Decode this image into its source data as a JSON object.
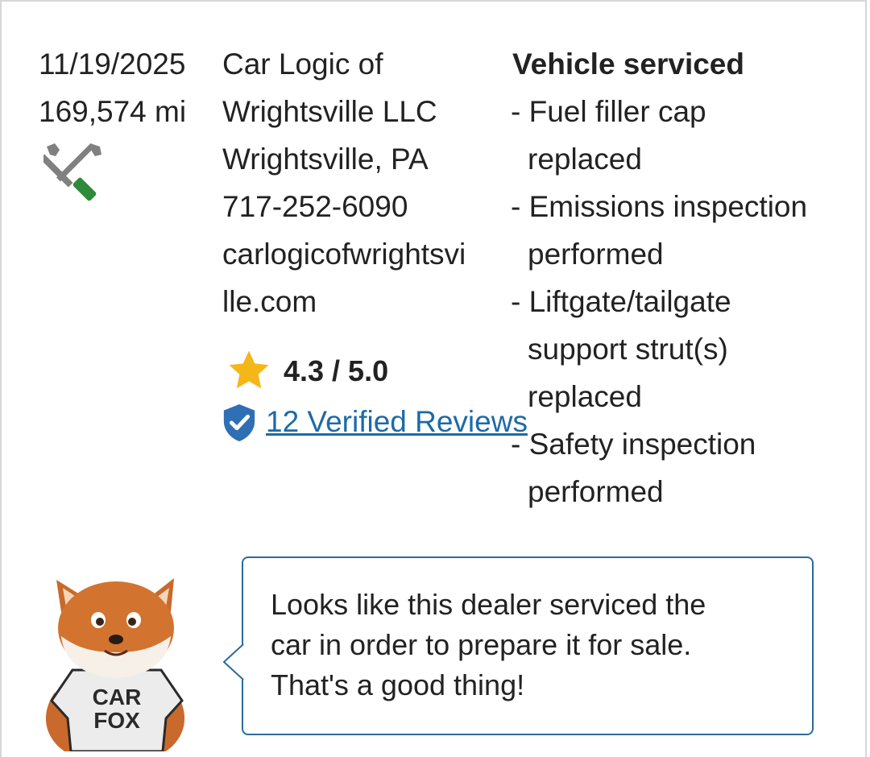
{
  "record": {
    "date": "11/19/2025",
    "mileage": "169,574 mi",
    "service_icon": "wrench-screwdriver-icon",
    "dealer": {
      "name_line1": "Car Logic of",
      "name_line2": "Wrightsville LLC",
      "location": "Wrightsville, PA",
      "phone": "717-252-6090",
      "website_line1": "carlogicofwrightsvi",
      "website_line2": "lle.com"
    },
    "rating": {
      "icon": "star-icon",
      "text": "4.3 / 5.0"
    },
    "reviews": {
      "icon": "verified-shield-icon",
      "link_text": "12 Verified Reviews"
    },
    "details": {
      "title": "Vehicle serviced",
      "lines": [
        "- Fuel filler cap",
        "  replaced",
        "- Emissions inspection",
        "  performed",
        "- Liftgate/tailgate",
        "  support strut(s)",
        "  replaced",
        "- Safety inspection",
        "  performed"
      ]
    }
  },
  "callout": {
    "mascot_shirt_line1": "CAR",
    "mascot_shirt_line2": "FOX",
    "lines": [
      "Looks like this dealer serviced the",
      "car in order to prepare it for sale.",
      "That's a good thing!"
    ]
  },
  "colors": {
    "link": "#1d6aa8",
    "star": "#f5b619",
    "shield": "#2e6fb5",
    "tool_gray": "#808080",
    "tool_green": "#2f8a3a",
    "bubble_border": "#2a6b9c"
  }
}
